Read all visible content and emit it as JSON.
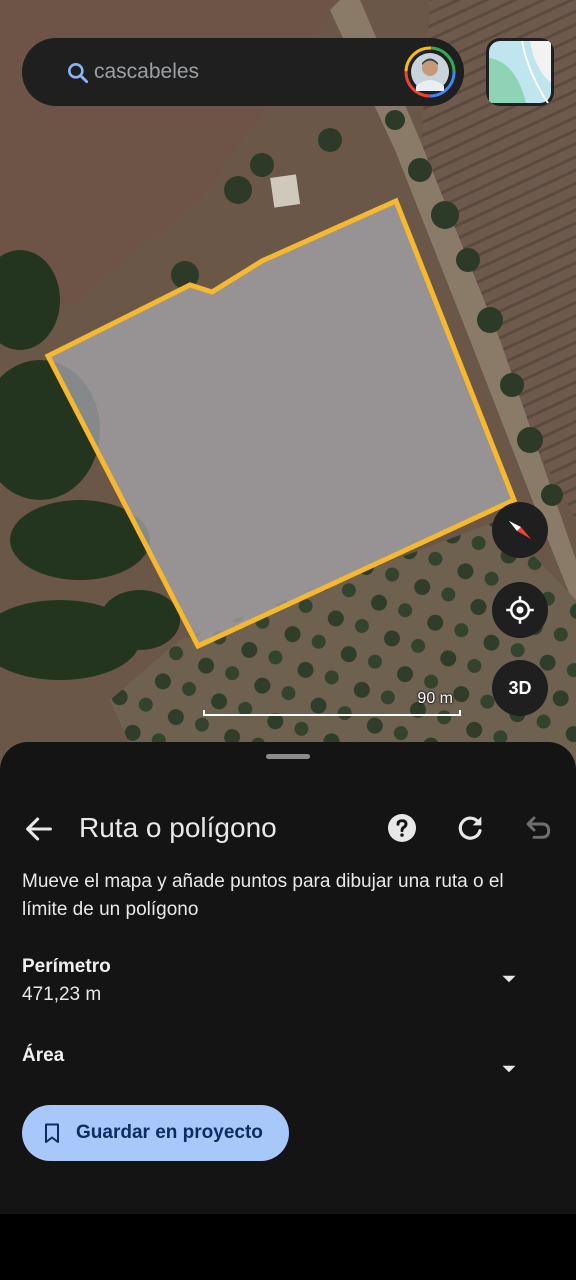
{
  "search": {
    "placeholder": "cascabeles"
  },
  "map": {
    "scale_label": "90 m",
    "view3d_label": "3D",
    "polygon_color": "#f5b82e"
  },
  "sheet": {
    "title": "Ruta o polígono",
    "instructions": "Mueve el mapa y añade puntos para dibujar una ruta o el límite de un polígono",
    "perimeter": {
      "label": "Perímetro",
      "value": "471,23 m"
    },
    "area": {
      "label": "Área",
      "value": ""
    },
    "save_label": "Guardar en proyecto"
  },
  "colors": {
    "accent": "#a8c7fa",
    "sheet_bg": "#141414",
    "control_bg": "#1f1f1f"
  },
  "icons": {
    "search": "search-icon",
    "back": "arrow-back-icon",
    "help": "help-icon",
    "refresh": "refresh-icon",
    "undo": "undo-icon",
    "dropdown": "caret-down-icon",
    "compass": "compass-icon",
    "location": "my-location-icon",
    "bookmark": "bookmark-icon",
    "layers": "map-layers-icon"
  }
}
